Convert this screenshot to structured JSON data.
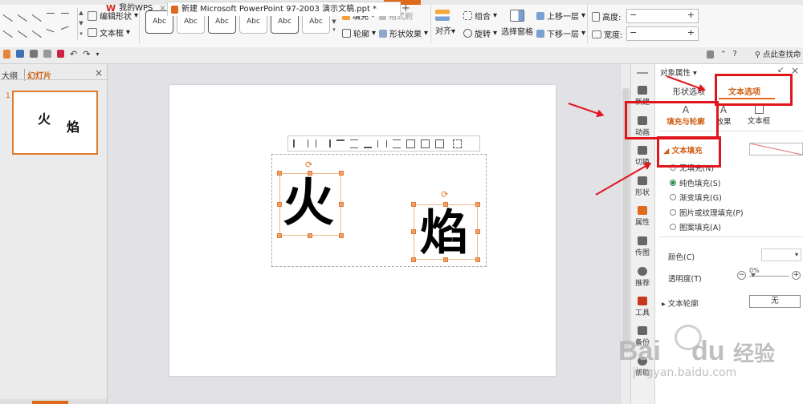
{
  "ribbon": {
    "edit_shape": "编辑形状",
    "text_box": "文本框",
    "style_sample": "Abc",
    "fill": "填充",
    "format_brush": "格式刷",
    "outline": "轮廓",
    "shape_effect": "形状效果",
    "align": "对齐",
    "group": "组合",
    "rotate": "旋转",
    "selection_pane": "选择窗格",
    "bring_forward": "上移一层",
    "send_backward": "下移一层",
    "height_label": "高度:",
    "width_label": "宽度:",
    "minus": "−",
    "plus": "+"
  },
  "tabbar": {
    "tab_wps": "我的WPS",
    "tab_doc": "新建 Microsoft PowerPoint 97-2003 演示文稿.ppt *",
    "new_tab": "+",
    "search": "点此查找命"
  },
  "left_panel": {
    "tab_outline": "大纲",
    "tab_slides": "幻灯片",
    "close": "×",
    "slide_number": "1",
    "thumb_char1": "火",
    "thumb_char2": "焰"
  },
  "slide": {
    "char1": "火",
    "char2": "焰"
  },
  "sidebar": {
    "items": [
      {
        "label": "新建"
      },
      {
        "label": "动画"
      },
      {
        "label": "切换"
      },
      {
        "label": "形状"
      },
      {
        "label": "属性"
      },
      {
        "label": "传图"
      },
      {
        "label": "推荐"
      },
      {
        "label": "工具"
      },
      {
        "label": "备份"
      },
      {
        "label": "帮助"
      }
    ]
  },
  "props": {
    "title": "对象属性",
    "tab_shape": "形状选项",
    "tab_text": "文本选项",
    "sub_fill_outline": "填充与轮廓",
    "sub_effect": "效果",
    "sub_textbox": "文本框",
    "section_text_fill": "文本填充",
    "options": [
      {
        "label": "无填充(N)"
      },
      {
        "label": "纯色填充(S)"
      },
      {
        "label": "渐变填充(G)"
      },
      {
        "label": "图片或纹理填充(P)"
      },
      {
        "label": "图案填充(A)"
      }
    ],
    "color_label": "颜色(C)",
    "transparency_label": "透明度(T)",
    "transparency_value": "0%",
    "text_outline": "文本轮廓",
    "outline_value": "无"
  },
  "colors": {
    "accent": "#e06a1b",
    "highlight": "#e0161d",
    "radio_selected": "#2c8c4c"
  },
  "watermark": {
    "brand": "Bai",
    "brand2": "du",
    "suffix": "经验",
    "url": "jingyan.baidu.com"
  }
}
